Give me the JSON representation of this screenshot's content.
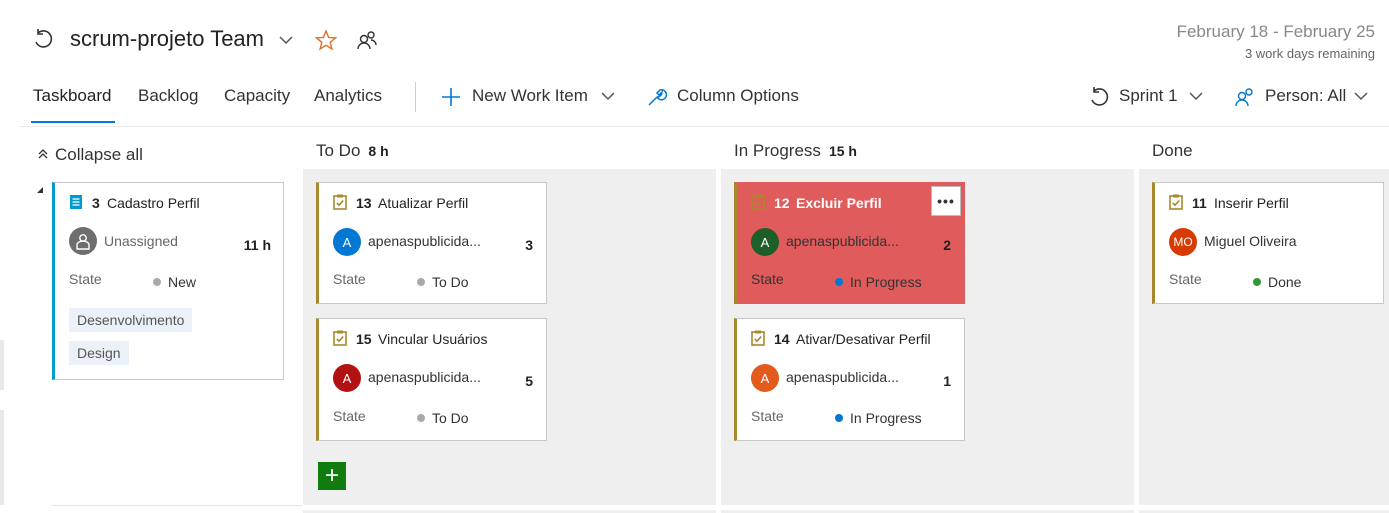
{
  "header": {
    "team_name": "scrum-projeto Team",
    "date_range": "February 18 - February 25",
    "days_remaining": "3 work days remaining"
  },
  "nav": {
    "tabs": [
      "Taskboard",
      "Backlog",
      "Capacity",
      "Analytics"
    ],
    "new_work_item": "New Work Item",
    "column_options": "Column Options",
    "sprint": "Sprint 1",
    "person": "Person: All"
  },
  "board": {
    "collapse_all": "Collapse all",
    "columns": [
      {
        "name": "To Do",
        "hours": "8 h"
      },
      {
        "name": "In Progress",
        "hours": "15 h"
      },
      {
        "name": "Done",
        "hours": ""
      }
    ],
    "story": {
      "id": "3",
      "title": "Cadastro Perfil",
      "assignee": "Unassigned",
      "hours": "11 h",
      "state_label": "State",
      "state": "New",
      "tags": [
        "Desenvolvimento",
        "Design"
      ]
    },
    "tasks": {
      "t13": {
        "id": "13",
        "title": "Atualizar Perfil",
        "avatar": "A",
        "assignee": "apenaspublicida...",
        "hours": "3",
        "state_label": "State",
        "state": "To Do"
      },
      "t15": {
        "id": "15",
        "title": "Vincular Usuários",
        "avatar": "A",
        "assignee": "apenaspublicida...",
        "hours": "5",
        "state_label": "State",
        "state": "To Do"
      },
      "t12": {
        "id": "12",
        "title": "Excluir Perfil",
        "avatar": "A",
        "assignee": "apenaspublicida...",
        "hours": "2",
        "state_label": "State",
        "state": "In Progress"
      },
      "t14": {
        "id": "14",
        "title": "Ativar/Desativar Perfil",
        "avatar": "A",
        "assignee": "apenaspublicida...",
        "hours": "1",
        "state_label": "State",
        "state": "In Progress"
      },
      "t11": {
        "id": "11",
        "title": "Inserir Perfil",
        "avatar": "MO",
        "assignee": "Miguel Oliveira",
        "hours": "",
        "state_label": "State",
        "state": "Done"
      }
    },
    "more_button": "•••",
    "add_button": "+"
  },
  "colors": {
    "accent": "#0078d4",
    "task_bar": "#a8882a",
    "story_bar": "#009ccc",
    "highlight_card": "#e05b5b",
    "state_new": "#aaaaaa",
    "state_todo": "#aaaaaa",
    "state_inprogress": "#0078d4",
    "state_done": "#339933",
    "add_button": "#107c10"
  },
  "icons": [
    "sprint-icon",
    "chevron-down-icon",
    "star-icon",
    "team-members-icon",
    "plus-icon",
    "wrench-icon",
    "person-icon",
    "collapse-icon",
    "story-icon",
    "task-icon",
    "unassigned-avatar-icon",
    "more-icon"
  ]
}
